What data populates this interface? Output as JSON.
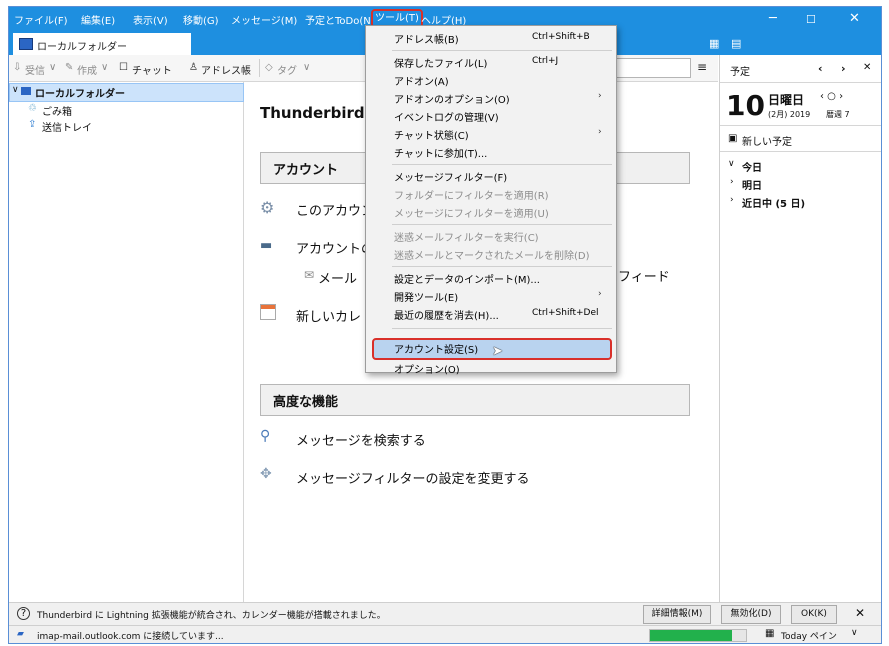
{
  "menubar": {
    "items": [
      "ファイル(F)",
      "編集(E)",
      "表示(V)",
      "移動(G)",
      "メッセージ(M)",
      "予定とToDo(N)",
      "ツール(T)",
      "ヘルプ(H)"
    ]
  },
  "tab": {
    "label": "ローカルフォルダー"
  },
  "toolbar": {
    "receive": "受信",
    "compose": "作成",
    "chat": "チャット",
    "address_book": "アドレス帳",
    "tag": "タグ"
  },
  "folders": {
    "root": "ローカルフォルダー",
    "trash": "ごみ箱",
    "outbox": "送信トレイ"
  },
  "main": {
    "title": "Thunderbird",
    "section_accounts": "アカウント",
    "row1": "このアカウン",
    "row2": "アカウントの",
    "mail": "メール",
    "feed": "フィード",
    "new_calendar": "新しいカレ",
    "section_advanced": "高度な機能",
    "search_messages": "メッセージを検索する",
    "change_filters": "メッセージフィルターの設定を変更する"
  },
  "tools_menu": {
    "items": [
      {
        "label": "アドレス帳(B)",
        "shortcut": "Ctrl+Shift+B"
      },
      {
        "label": "保存したファイル(L)",
        "shortcut": "Ctrl+J"
      },
      {
        "label": "アドオン(A)"
      },
      {
        "label": "アドオンのオプション(O)"
      },
      {
        "label": "イベントログの管理(V)"
      },
      {
        "label": "チャット状態(C)"
      },
      {
        "label": "チャットに参加(T)..."
      },
      {
        "label": "メッセージフィルター(F)"
      },
      {
        "label": "フォルダーにフィルターを適用(R)"
      },
      {
        "label": "メッセージにフィルターを適用(U)"
      },
      {
        "label": "迷惑メールフィルターを実行(C)"
      },
      {
        "label": "迷惑メールとマークされたメールを削除(D)"
      },
      {
        "label": "設定とデータのインポート(M)..."
      },
      {
        "label": "開発ツール(E)"
      },
      {
        "label": "最近の履歴を消去(H)...",
        "shortcut": "Ctrl+Shift+Del"
      },
      {
        "label": "アカウント設定(S)"
      },
      {
        "label": "オプション(O)"
      }
    ]
  },
  "calendar": {
    "header": "予定",
    "day": "10",
    "weekday": "日曜日",
    "month_year": "(2月) 2019",
    "week": "暦週 7",
    "new_event": "新しい予定",
    "groups": [
      "今日",
      "明日",
      "近日中 (5 日)"
    ]
  },
  "notification": {
    "text": "Thunderbird に Lightning 拡張機能が統合され、カレンダー機能が搭載されました。",
    "details": "詳細情報(M)",
    "disable": "無効化(D)",
    "ok": "OK(K)"
  },
  "status": {
    "text": "imap-mail.outlook.com に接続しています...",
    "today_pane": "Today ペイン",
    "progress": 0.85
  },
  "colors": {
    "titlebar": "#1e8fe0",
    "highlight_border": "#d9302a",
    "selection": "#b9d3ef",
    "progress": "#22b14c"
  }
}
